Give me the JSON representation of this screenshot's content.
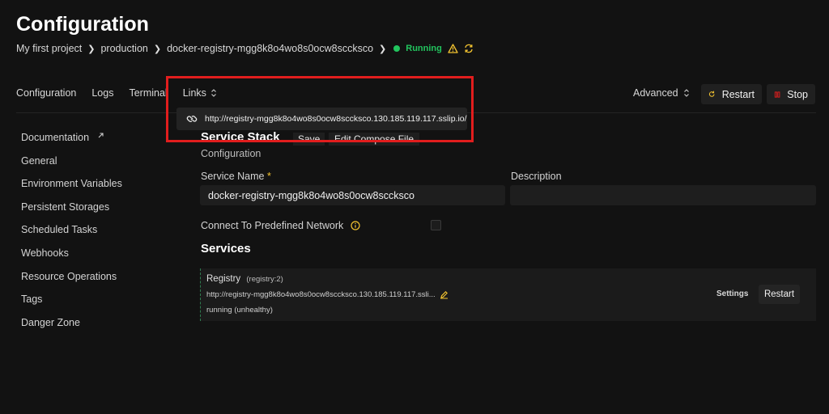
{
  "header": {
    "title": "Configuration",
    "breadcrumb": [
      "My first project",
      "production",
      "docker-registry-mgg8k8o4wo8s0ocw8scckscо"
    ],
    "status": "Running"
  },
  "tabs": [
    "Configuration",
    "Logs",
    "Terminal"
  ],
  "links_label": "Links",
  "links_popup_url": "http://registry-mgg8k8o4wo8s0ocw8scckscо.130.185.119.117.sslip.io/",
  "toolbar": {
    "advanced_label": "Advanced",
    "restart_label": "Restart",
    "stop_label": "Stop"
  },
  "sidebar": {
    "items": [
      "Documentation",
      "General",
      "Environment Variables",
      "Persistent Storages",
      "Scheduled Tasks",
      "Webhooks",
      "Resource Operations",
      "Tags",
      "Danger Zone"
    ]
  },
  "main": {
    "section_title": "Service Stack",
    "save_label": "Save",
    "edit_compose_label": "Edit Compose File",
    "section_subtitle": "Configuration",
    "service_name_label": "Service Name",
    "required_marker": "*",
    "service_name_value": "docker-registry-mgg8k8o4wo8s0ocw8scckscо",
    "description_label": "Description",
    "description_value": "",
    "network_label": "Connect To Predefined Network",
    "network_checked": false,
    "services_title": "Services",
    "service": {
      "name": "Registry",
      "image": "(registry:2)",
      "url": "http://registry-mgg8k8o4wo8s0ocw8scckscо.130.185.119.117.ssli...",
      "status": "running (unhealthy)",
      "settings_label": "Settings",
      "restart_label": "Restart"
    }
  },
  "colors": {
    "accent_green": "#22c55e",
    "warning_yellow": "#f4c430",
    "stop_red": "#e11d1d",
    "highlight_red": "#e11d1d"
  }
}
